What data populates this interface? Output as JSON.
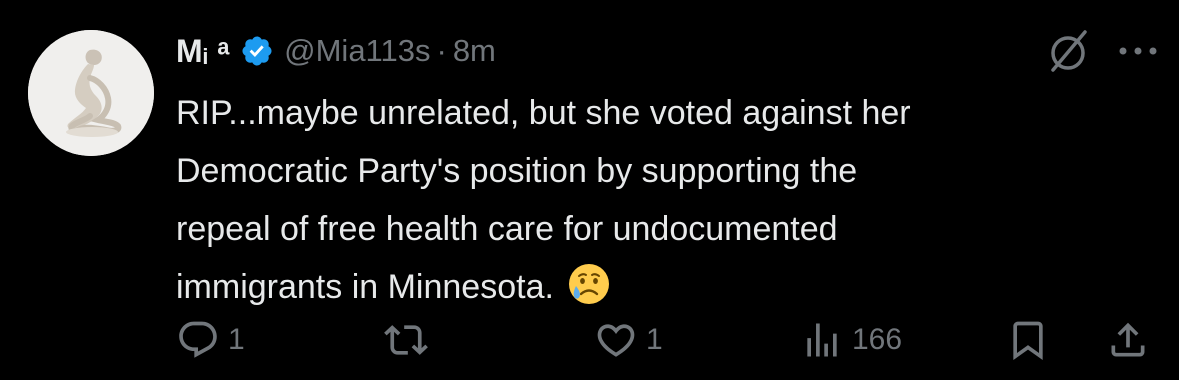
{
  "author": {
    "name": "Mᵢ ᵃ",
    "handle": "@Mia113s",
    "separator": "·",
    "time": "8m",
    "verified": true,
    "verified_color": "#1d9bf0"
  },
  "tweet": {
    "text": "RIP...maybe unrelated, but she voted against her\nDemocratic Party's position by supporting the\nrepeal of free health care for undocumented\nimmigrants in Minnesota. ",
    "emoji_icon": "sad-but-relieved-face-icon"
  },
  "actions": {
    "reply_count": "1",
    "retweet_count": "",
    "like_count": "1",
    "views_count": "166"
  },
  "colors": {
    "background": "#000000",
    "text": "#e7e9ea",
    "muted": "#71767b"
  }
}
